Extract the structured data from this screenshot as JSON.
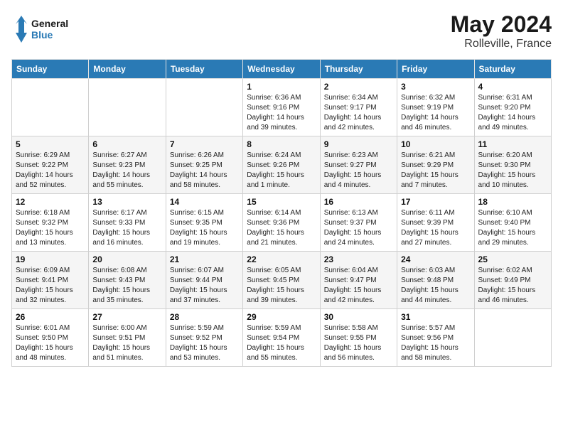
{
  "header": {
    "logo_general": "General",
    "logo_blue": "Blue",
    "month": "May 2024",
    "location": "Rolleville, France"
  },
  "weekdays": [
    "Sunday",
    "Monday",
    "Tuesday",
    "Wednesday",
    "Thursday",
    "Friday",
    "Saturday"
  ],
  "weeks": [
    [
      {
        "day": "",
        "info": ""
      },
      {
        "day": "",
        "info": ""
      },
      {
        "day": "",
        "info": ""
      },
      {
        "day": "1",
        "info": "Sunrise: 6:36 AM\nSunset: 9:16 PM\nDaylight: 14 hours and 39 minutes."
      },
      {
        "day": "2",
        "info": "Sunrise: 6:34 AM\nSunset: 9:17 PM\nDaylight: 14 hours and 42 minutes."
      },
      {
        "day": "3",
        "info": "Sunrise: 6:32 AM\nSunset: 9:19 PM\nDaylight: 14 hours and 46 minutes."
      },
      {
        "day": "4",
        "info": "Sunrise: 6:31 AM\nSunset: 9:20 PM\nDaylight: 14 hours and 49 minutes."
      }
    ],
    [
      {
        "day": "5",
        "info": "Sunrise: 6:29 AM\nSunset: 9:22 PM\nDaylight: 14 hours and 52 minutes."
      },
      {
        "day": "6",
        "info": "Sunrise: 6:27 AM\nSunset: 9:23 PM\nDaylight: 14 hours and 55 minutes."
      },
      {
        "day": "7",
        "info": "Sunrise: 6:26 AM\nSunset: 9:25 PM\nDaylight: 14 hours and 58 minutes."
      },
      {
        "day": "8",
        "info": "Sunrise: 6:24 AM\nSunset: 9:26 PM\nDaylight: 15 hours and 1 minute."
      },
      {
        "day": "9",
        "info": "Sunrise: 6:23 AM\nSunset: 9:27 PM\nDaylight: 15 hours and 4 minutes."
      },
      {
        "day": "10",
        "info": "Sunrise: 6:21 AM\nSunset: 9:29 PM\nDaylight: 15 hours and 7 minutes."
      },
      {
        "day": "11",
        "info": "Sunrise: 6:20 AM\nSunset: 9:30 PM\nDaylight: 15 hours and 10 minutes."
      }
    ],
    [
      {
        "day": "12",
        "info": "Sunrise: 6:18 AM\nSunset: 9:32 PM\nDaylight: 15 hours and 13 minutes."
      },
      {
        "day": "13",
        "info": "Sunrise: 6:17 AM\nSunset: 9:33 PM\nDaylight: 15 hours and 16 minutes."
      },
      {
        "day": "14",
        "info": "Sunrise: 6:15 AM\nSunset: 9:35 PM\nDaylight: 15 hours and 19 minutes."
      },
      {
        "day": "15",
        "info": "Sunrise: 6:14 AM\nSunset: 9:36 PM\nDaylight: 15 hours and 21 minutes."
      },
      {
        "day": "16",
        "info": "Sunrise: 6:13 AM\nSunset: 9:37 PM\nDaylight: 15 hours and 24 minutes."
      },
      {
        "day": "17",
        "info": "Sunrise: 6:11 AM\nSunset: 9:39 PM\nDaylight: 15 hours and 27 minutes."
      },
      {
        "day": "18",
        "info": "Sunrise: 6:10 AM\nSunset: 9:40 PM\nDaylight: 15 hours and 29 minutes."
      }
    ],
    [
      {
        "day": "19",
        "info": "Sunrise: 6:09 AM\nSunset: 9:41 PM\nDaylight: 15 hours and 32 minutes."
      },
      {
        "day": "20",
        "info": "Sunrise: 6:08 AM\nSunset: 9:43 PM\nDaylight: 15 hours and 35 minutes."
      },
      {
        "day": "21",
        "info": "Sunrise: 6:07 AM\nSunset: 9:44 PM\nDaylight: 15 hours and 37 minutes."
      },
      {
        "day": "22",
        "info": "Sunrise: 6:05 AM\nSunset: 9:45 PM\nDaylight: 15 hours and 39 minutes."
      },
      {
        "day": "23",
        "info": "Sunrise: 6:04 AM\nSunset: 9:47 PM\nDaylight: 15 hours and 42 minutes."
      },
      {
        "day": "24",
        "info": "Sunrise: 6:03 AM\nSunset: 9:48 PM\nDaylight: 15 hours and 44 minutes."
      },
      {
        "day": "25",
        "info": "Sunrise: 6:02 AM\nSunset: 9:49 PM\nDaylight: 15 hours and 46 minutes."
      }
    ],
    [
      {
        "day": "26",
        "info": "Sunrise: 6:01 AM\nSunset: 9:50 PM\nDaylight: 15 hours and 48 minutes."
      },
      {
        "day": "27",
        "info": "Sunrise: 6:00 AM\nSunset: 9:51 PM\nDaylight: 15 hours and 51 minutes."
      },
      {
        "day": "28",
        "info": "Sunrise: 5:59 AM\nSunset: 9:52 PM\nDaylight: 15 hours and 53 minutes."
      },
      {
        "day": "29",
        "info": "Sunrise: 5:59 AM\nSunset: 9:54 PM\nDaylight: 15 hours and 55 minutes."
      },
      {
        "day": "30",
        "info": "Sunrise: 5:58 AM\nSunset: 9:55 PM\nDaylight: 15 hours and 56 minutes."
      },
      {
        "day": "31",
        "info": "Sunrise: 5:57 AM\nSunset: 9:56 PM\nDaylight: 15 hours and 58 minutes."
      },
      {
        "day": "",
        "info": ""
      }
    ]
  ]
}
